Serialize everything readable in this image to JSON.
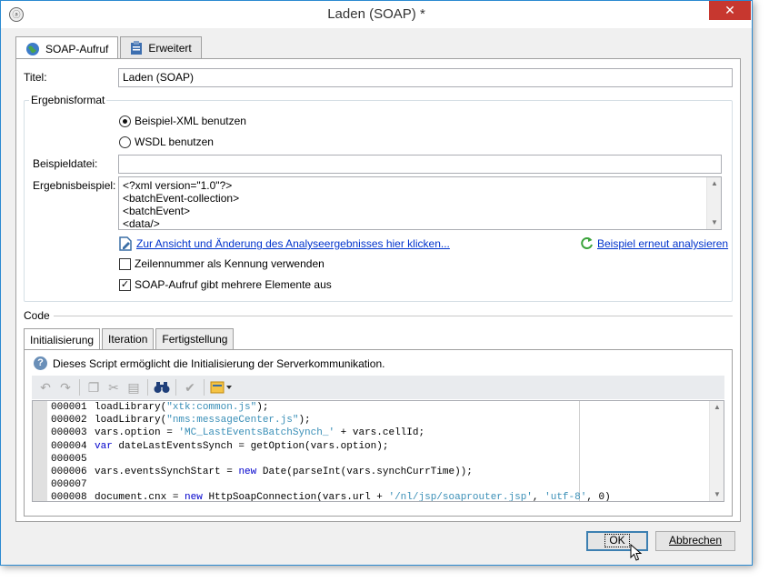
{
  "window": {
    "title": "Laden (SOAP) *",
    "app_icon": "adobe-campaign-icon",
    "close_label": "✕"
  },
  "tabs": [
    {
      "label": "SOAP-Aufruf",
      "icon": "globe-icon",
      "active": true
    },
    {
      "label": "Erweitert",
      "icon": "clipboard-icon",
      "active": false
    }
  ],
  "form": {
    "title_label": "Titel:",
    "title_value": "Laden (SOAP)",
    "result_group": "Ergebnisformat",
    "radio_xml": "Beispiel-XML benutzen",
    "radio_xml_selected": true,
    "radio_wsdl": "WSDL benutzen",
    "sample_file_label": "Beispieldatei:",
    "sample_file_value": "",
    "sample_result_label": "Ergebnisbeispiel:",
    "sample_result_lines": [
      "<?xml version=\"1.0\"?>",
      "<batchEvent-collection>",
      " <batchEvent>",
      "<data/>"
    ],
    "analysis_link": "Zur Ansicht und Änderung des Analyseergebnisses hier klicken...",
    "reanalyze_link": "Beispiel erneut analysieren",
    "checkbox_line_number": "Zeilennummer als Kennung verwenden",
    "checkbox_line_number_checked": false,
    "checkbox_multiple": "SOAP-Aufruf gibt mehrere Elemente aus",
    "checkbox_multiple_checked": true
  },
  "code": {
    "section_label": "Code",
    "tabs": [
      {
        "label": "Initialisierung",
        "active": true
      },
      {
        "label": "Iteration",
        "active": false
      },
      {
        "label": "Fertigstellung",
        "active": false
      }
    ],
    "info_text": "Dieses Script ermöglicht die Initialisierung der Serverkommunikation.",
    "toolbar": [
      "undo-icon",
      "redo-icon",
      "copy-icon",
      "cut-icon",
      "paste-icon",
      "find-icon",
      "check-icon",
      "insert-field-icon"
    ],
    "lines": [
      {
        "num": "000001",
        "text": "loadLibrary(\"xtk:common.js\");"
      },
      {
        "num": "000002",
        "text": "loadLibrary(\"nms:messageCenter.js\");"
      },
      {
        "num": "000003",
        "text": "vars.option = 'MC_LastEventsBatchSynch_' + vars.cellId;"
      },
      {
        "num": "000004",
        "text": "var dateLastEventsSynch = getOption(vars.option);"
      },
      {
        "num": "000005",
        "text": ""
      },
      {
        "num": "000006",
        "text": "vars.eventsSynchStart = new Date(parseInt(vars.synchCurrTime));"
      },
      {
        "num": "000007",
        "text": ""
      },
      {
        "num": "000008",
        "text": "document.cnx = new HttpSoapConnection(vars.url + '/nl/jsp/soaprouter.jsp', 'utf-8', 0)"
      }
    ]
  },
  "buttons": {
    "ok": "OK",
    "cancel": "Abbrechen"
  }
}
